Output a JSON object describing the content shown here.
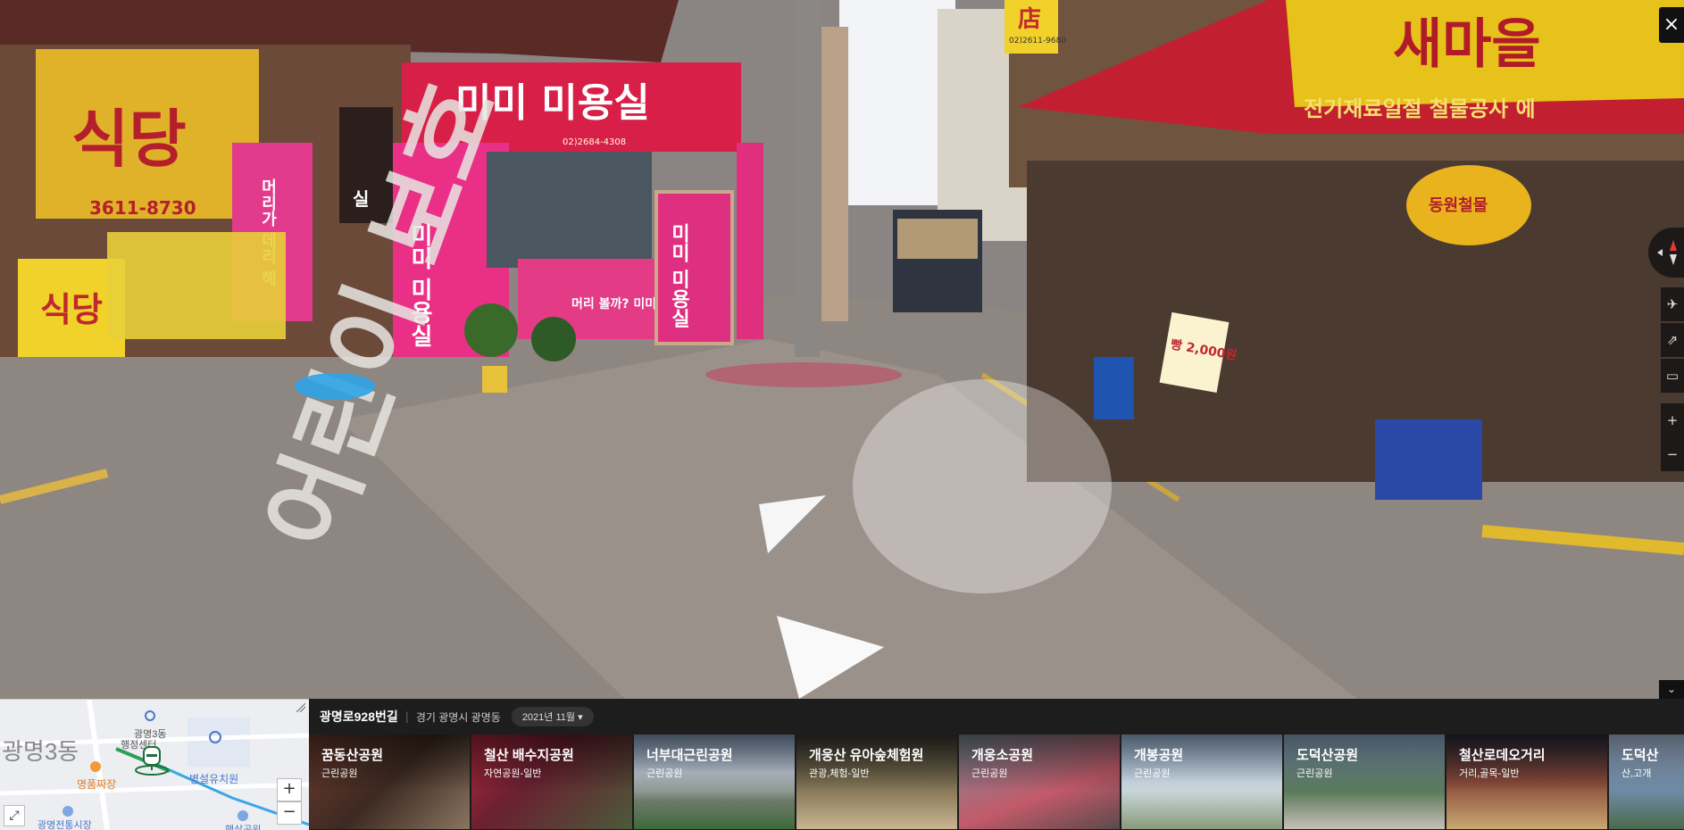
{
  "scene": {
    "signs": {
      "salon_main": "미미 미용실",
      "salon_phone": "02)2684-4308",
      "salon_door": "미미 미용실",
      "salon_side": "미미 미용실",
      "salon_poster": "머리 볼까? 미미미용실",
      "left_shop": "식당",
      "left_phone": "3611-8730",
      "left_vertical": "머리가 데리 해",
      "left_yellow": "식당",
      "right_banner": "새마을",
      "right_sub": "전기재료일절 철물공사 에",
      "right_round": "동원철물",
      "top_sign": "店",
      "top_phone": "02)2611-9680",
      "food_board": "빵 2,000원",
      "vertical_sign": "실"
    },
    "road_marking": "어린이 보호"
  },
  "controls": {
    "close": "×",
    "collapse": "⌄",
    "airplane": "✈",
    "share": "⇗",
    "feedback": "▭",
    "zoom_in": "+",
    "zoom_out": "−"
  },
  "minimap": {
    "labels": {
      "district": "광명3동",
      "office_top": "광명3동",
      "office_bottom": "행정센터",
      "restaurant": "명품짜장",
      "kindergarten": "병설유치원",
      "market": "광명전통시장",
      "park": "햇살공원"
    },
    "zoom_in": "+",
    "zoom_out": "−",
    "expand": "⤢"
  },
  "info": {
    "address": "광명로928번길",
    "region": "경기 광명시 광명동",
    "date": "2021년 11월"
  },
  "places": [
    {
      "name": "꿈동산공원",
      "category": "근린공원"
    },
    {
      "name": "철산 배수지공원",
      "category": "자연공원-일반"
    },
    {
      "name": "너부대근린공원",
      "category": "근린공원"
    },
    {
      "name": "개웅산 유아숲체험원",
      "category": "관광,체험-일반"
    },
    {
      "name": "개웅소공원",
      "category": "근린공원"
    },
    {
      "name": "개봉공원",
      "category": "근린공원"
    },
    {
      "name": "도덕산공원",
      "category": "근린공원"
    },
    {
      "name": "철산로데오거리",
      "category": "거리,골목-일반"
    },
    {
      "name": "도덕산",
      "category": "산,고개"
    }
  ]
}
